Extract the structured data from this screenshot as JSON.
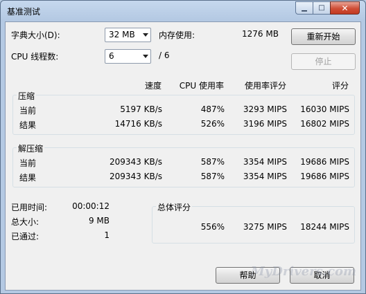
{
  "window": {
    "title": "基准测试"
  },
  "titlebar": {
    "min_glyph": "▁",
    "max_glyph": "□",
    "close_glyph": "✕"
  },
  "settings": {
    "dict_label": "字典大小(D):",
    "dict_value": "32 MB",
    "mem_label": "内存使用:",
    "mem_value": "1276 MB",
    "threads_label": "CPU 线程数:",
    "threads_value": "6",
    "threads_total": "/ 6"
  },
  "buttons": {
    "restart": "重新开始",
    "stop": "停止",
    "help": "帮助",
    "cancel": "取消"
  },
  "columns": {
    "speed": "速度",
    "cpu_usage": "CPU 使用率",
    "usage_rating": "使用率评分",
    "rating": "评分"
  },
  "compress": {
    "title": "压缩",
    "rows": [
      {
        "label": "当前",
        "speed": "5197 KB/s",
        "cpu": "487%",
        "usage_rating": "3293 MIPS",
        "rating": "16030 MIPS"
      },
      {
        "label": "结果",
        "speed": "14716 KB/s",
        "cpu": "526%",
        "usage_rating": "3196 MIPS",
        "rating": "16802 MIPS"
      }
    ]
  },
  "decompress": {
    "title": "解压缩",
    "rows": [
      {
        "label": "当前",
        "speed": "209343 KB/s",
        "cpu": "587%",
        "usage_rating": "3354 MIPS",
        "rating": "19686 MIPS"
      },
      {
        "label": "结果",
        "speed": "209343 KB/s",
        "cpu": "587%",
        "usage_rating": "3354 MIPS",
        "rating": "19686 MIPS"
      }
    ]
  },
  "stats": {
    "elapsed_label": "已用时间:",
    "elapsed_value": "00:00:12",
    "size_label": "总大小:",
    "size_value": "9 MB",
    "passes_label": "已通过:",
    "passes_value": "1"
  },
  "total": {
    "title": "总体评分",
    "cpu": "556%",
    "usage_rating": "3275 MIPS",
    "rating": "18244 MIPS"
  },
  "watermark": "MyDrivers.com"
}
